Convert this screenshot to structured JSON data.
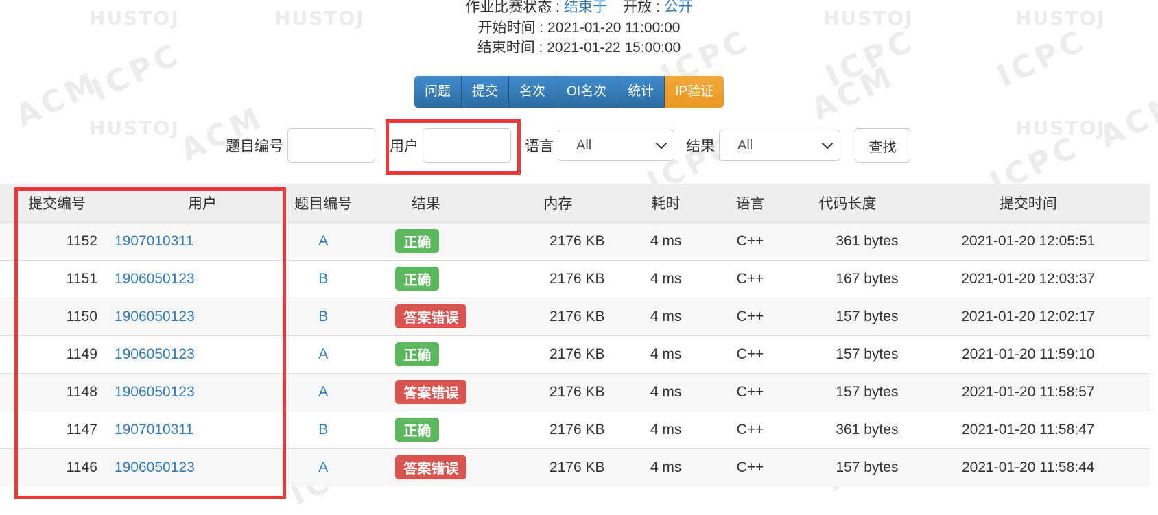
{
  "contest_info": {
    "status_label": "作业比赛状态 : ",
    "status_value": "结束于",
    "access_label": "开放 : ",
    "access_value": "公开",
    "start_time": "开始时间 : 2021-01-20 11:00:00",
    "end_time": "结束时间 : 2021-01-22 15:00:00"
  },
  "nav_tabs": [
    "问题",
    "提交",
    "名次",
    "OI名次",
    "统计",
    "IP验证"
  ],
  "filter": {
    "problem_label": "题目编号",
    "problem_value": "",
    "user_label": "用户",
    "user_value": "",
    "language_label": "语言",
    "language_selected": "All",
    "result_label": "结果",
    "result_selected": "All",
    "search_button": "查找"
  },
  "table": {
    "headers": [
      "提交编号",
      "用户",
      "题目编号",
      "结果",
      "内存",
      "耗时",
      "语言",
      "代码长度",
      "提交时间"
    ],
    "rows": [
      {
        "id": "1152",
        "user": "1907010311",
        "problem": "A",
        "result": "正确",
        "result_type": "ok",
        "memory": "2176 KB",
        "time": "4 ms",
        "language": "C++",
        "length": "361 bytes",
        "submitted": "2021-01-20 12:05:51"
      },
      {
        "id": "1151",
        "user": "1906050123",
        "problem": "B",
        "result": "正确",
        "result_type": "ok",
        "memory": "2176 KB",
        "time": "4 ms",
        "language": "C++",
        "length": "167 bytes",
        "submitted": "2021-01-20 12:03:37"
      },
      {
        "id": "1150",
        "user": "1906050123",
        "problem": "B",
        "result": "答案错误",
        "result_type": "wa",
        "memory": "2176 KB",
        "time": "4 ms",
        "language": "C++",
        "length": "157 bytes",
        "submitted": "2021-01-20 12:02:17"
      },
      {
        "id": "1149",
        "user": "1906050123",
        "problem": "A",
        "result": "正确",
        "result_type": "ok",
        "memory": "2176 KB",
        "time": "4 ms",
        "language": "C++",
        "length": "157 bytes",
        "submitted": "2021-01-20 11:59:10"
      },
      {
        "id": "1148",
        "user": "1906050123",
        "problem": "A",
        "result": "答案错误",
        "result_type": "wa",
        "memory": "2176 KB",
        "time": "4 ms",
        "language": "C++",
        "length": "157 bytes",
        "submitted": "2021-01-20 11:58:57"
      },
      {
        "id": "1147",
        "user": "1907010311",
        "problem": "B",
        "result": "正确",
        "result_type": "ok",
        "memory": "2176 KB",
        "time": "4 ms",
        "language": "C++",
        "length": "361 bytes",
        "submitted": "2021-01-20 11:58:47"
      },
      {
        "id": "1146",
        "user": "1906050123",
        "problem": "A",
        "result": "答案错误",
        "result_type": "wa",
        "memory": "2176 KB",
        "time": "4 ms",
        "language": "C++",
        "length": "157 bytes",
        "submitted": "2021-01-20 11:58:44"
      }
    ]
  },
  "watermark_words": [
    "HUSTOJ",
    "ACM",
    "ICPC"
  ],
  "colors": {
    "link": "#337ab7",
    "accepted": "#5cb85c",
    "wrong_answer": "#d9534f",
    "highlight_box": "#ef3838",
    "primary_button": "#337ab7",
    "warning_button": "#f0ad4e"
  }
}
